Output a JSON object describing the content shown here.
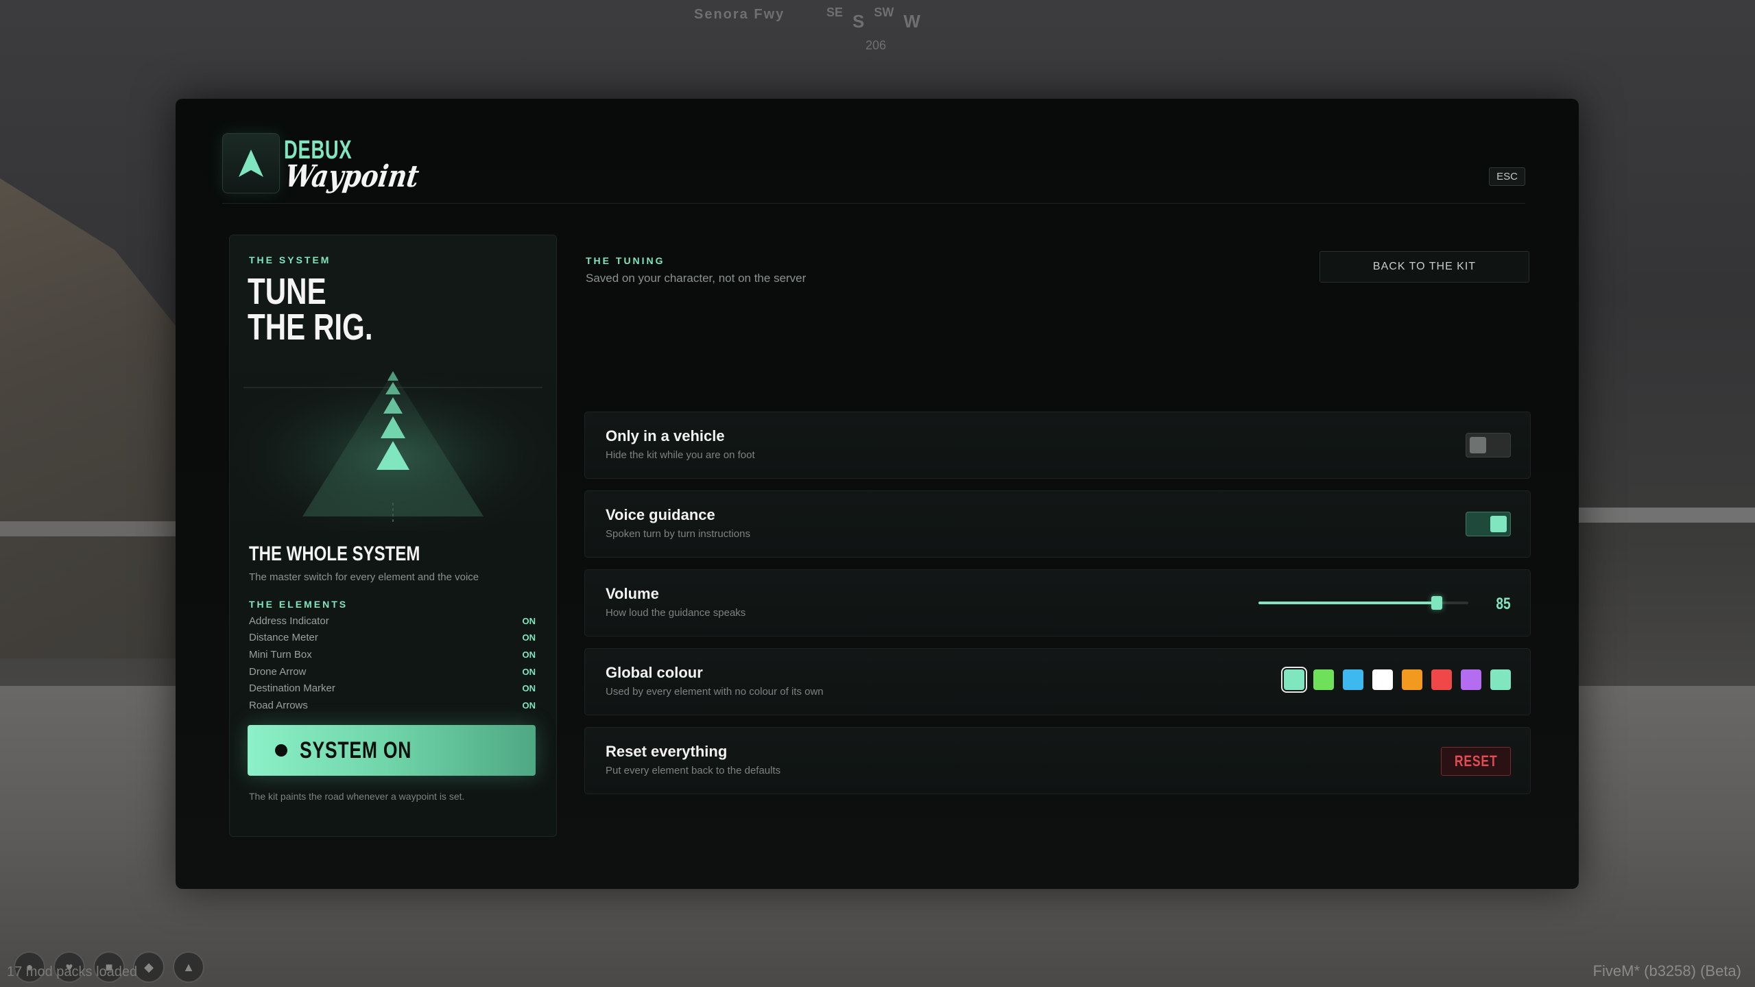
{
  "hud": {
    "street": "Senora Fwy",
    "compass": [
      "SE",
      "S",
      "SW",
      "W"
    ],
    "heading": "206",
    "status": "17 mod packs loaded",
    "client": "FiveM* (b3258) (Beta)"
  },
  "brand": {
    "line1": "DEBUX",
    "line2": "Waypoint",
    "accent": "#7fe6bf"
  },
  "esc_label": "ESC",
  "system": {
    "eyebrow": "THE SYSTEM",
    "title_line1": "TUNE",
    "title_line2": "THE RIG.",
    "section_title": "THE WHOLE SYSTEM",
    "section_sub": "The master switch for every element and the voice",
    "elements_eyebrow": "THE ELEMENTS",
    "elements": [
      {
        "name": "Address Indicator",
        "state": "ON"
      },
      {
        "name": "Distance Meter",
        "state": "ON"
      },
      {
        "name": "Mini Turn Box",
        "state": "ON"
      },
      {
        "name": "Drone Arrow",
        "state": "ON"
      },
      {
        "name": "Destination Marker",
        "state": "ON"
      },
      {
        "name": "Road Arrows",
        "state": "ON"
      }
    ],
    "button_label": "SYSTEM ON",
    "footnote": "The kit paints the road whenever a waypoint is set."
  },
  "tuning": {
    "eyebrow": "THE TUNING",
    "subtitle": "Saved on your character, not on the server",
    "back_label": "BACK TO THE KIT",
    "only_vehicle": {
      "name": "Only in a vehicle",
      "desc": "Hide the kit while you are on foot",
      "enabled": false
    },
    "voice": {
      "name": "Voice guidance",
      "desc": "Spoken turn by turn instructions",
      "enabled": true
    },
    "volume": {
      "name": "Volume",
      "desc": "How loud the guidance speaks",
      "value": 85,
      "max": 100,
      "display": "85"
    },
    "colour": {
      "name": "Global colour",
      "desc": "Used by every element with no colour of its own",
      "options": [
        "#7fe6bf",
        "#6fe05a",
        "#3db9f0",
        "#ffffff",
        "#f29a1f",
        "#f04848",
        "#b46cf0",
        "#7fe6bf"
      ],
      "selected_index": 0
    },
    "reset": {
      "name": "Reset everything",
      "desc": "Put every element back to the defaults",
      "button": "RESET"
    }
  }
}
